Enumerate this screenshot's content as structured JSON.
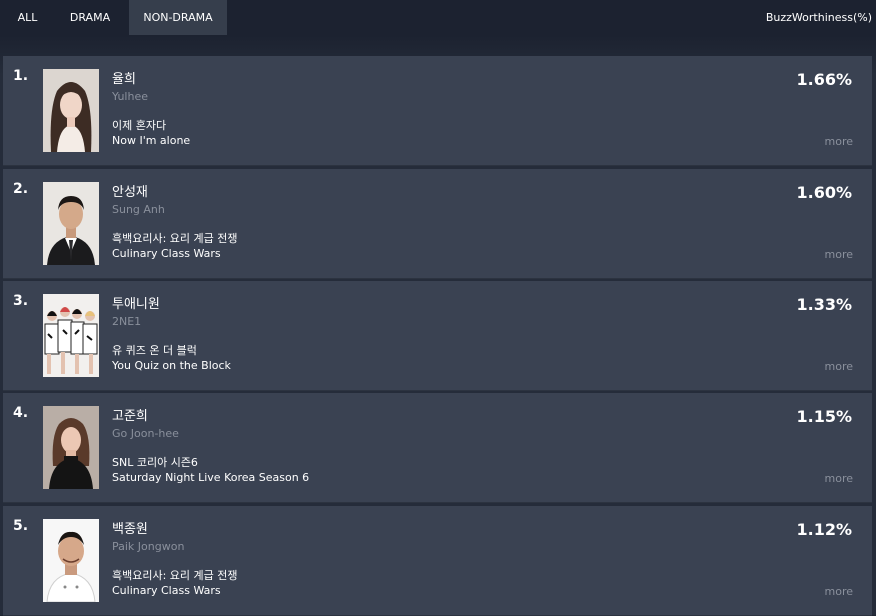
{
  "tabs": [
    {
      "label": "ALL",
      "active": false
    },
    {
      "label": "DRAMA",
      "active": false
    },
    {
      "label": "NON-DRAMA",
      "active": true
    }
  ],
  "buzz_label": "BuzzWorthiness(%)",
  "more_label": "more",
  "entries": [
    {
      "rank": "1.",
      "name_ko": "율희",
      "name_en": "Yulhee",
      "show_ko": "이제 혼자다",
      "show_en": "Now I'm alone",
      "score": "1.66%",
      "photo_icon": "portrait-woman-light"
    },
    {
      "rank": "2.",
      "name_ko": "안성재",
      "name_en": "Sung Anh",
      "show_ko": "흑백요리사: 요리 계급 전쟁",
      "show_en": "Culinary Class Wars",
      "score": "1.60%",
      "photo_icon": "portrait-man-suit"
    },
    {
      "rank": "3.",
      "name_ko": "투애니원",
      "name_en": "2NE1",
      "show_ko": "유 퀴즈 온 더 블럭",
      "show_en": "You Quiz on the Block",
      "score": "1.33%",
      "photo_icon": "group-portrait"
    },
    {
      "rank": "4.",
      "name_ko": "고준희",
      "name_en": "Go Joon-hee",
      "show_ko": "SNL 코리아 시즌6",
      "show_en": "Saturday Night Live Korea Season 6",
      "score": "1.15%",
      "photo_icon": "portrait-woman-dark"
    },
    {
      "rank": "5.",
      "name_ko": "백종원",
      "name_en": "Paik Jongwon",
      "show_ko": "흑백요리사: 요리 계급 전쟁",
      "show_en": "Culinary Class Wars",
      "score": "1.12%",
      "photo_icon": "portrait-chef"
    }
  ],
  "colors": {
    "background": "#1e2532",
    "card": "#3a4252",
    "active_tab": "#363e4c",
    "muted_text": "#8a909c"
  }
}
